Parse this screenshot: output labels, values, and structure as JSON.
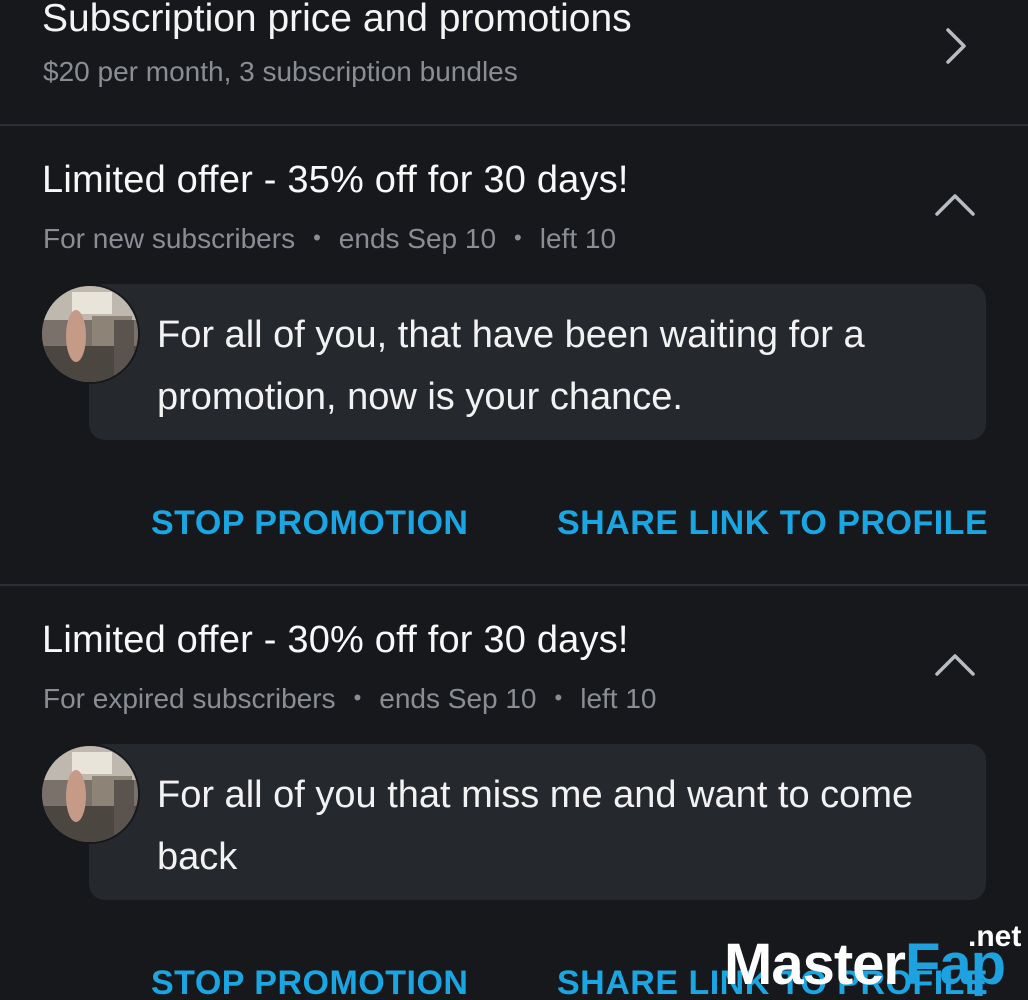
{
  "subscription": {
    "title": "Subscription price and promotions",
    "subtitle": "$20 per month, 3 subscription bundles",
    "chevron_icon": "chevron-right-icon"
  },
  "promotions": [
    {
      "title": "Limited offer - 35% off for 30 days!",
      "audience": "For new subscribers",
      "ends": "ends Sep 10",
      "left": "left 10",
      "message": "For all of you, that have been waiting for a promotion, now is your chance.",
      "stop_label": "STOP PROMOTION",
      "share_label": "SHARE LINK TO PROFILE",
      "separator": "•",
      "toggle_icon": "chevron-up-icon"
    },
    {
      "title": "Limited offer - 30% off for 30 days!",
      "audience": "For expired subscribers",
      "ends": "ends Sep 10",
      "left": "left 10",
      "message": "For all of you that miss me and want to come back",
      "stop_label": "STOP PROMOTION",
      "share_label": "SHARE LINK TO PROFILE",
      "separator": "•",
      "toggle_icon": "chevron-up-icon"
    }
  ],
  "watermark": {
    "master": "Master",
    "fap": "Fap",
    "net": ".net"
  },
  "colors": {
    "background": "#16181c",
    "bubble": "#25282d",
    "accent": "#1aa6e2",
    "muted_text": "#8a8d94",
    "divider": "#2c2f35"
  }
}
